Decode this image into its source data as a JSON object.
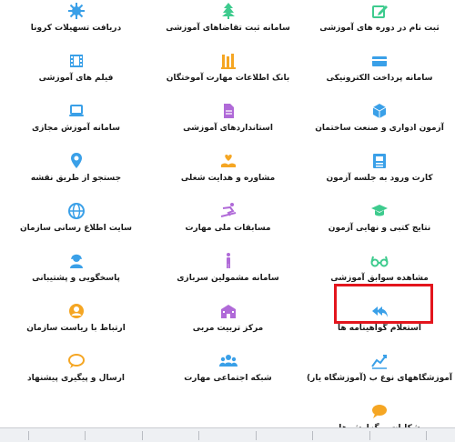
{
  "colors": {
    "orange": "#f5a623",
    "green": "#3ecb8e",
    "blue": "#3aa0e8",
    "pink": "#b06ad8",
    "highlight": "#e3151d"
  },
  "items": [
    {
      "id": "course-registration",
      "label": "ثبت نام در دوره های آموزشی",
      "icon": "edit-icon",
      "color": "green"
    },
    {
      "id": "training-requests",
      "label": "سامانه ثبت تقاضاهای آموزشی",
      "icon": "tree-icon",
      "color": "green"
    },
    {
      "id": "corona-facilities",
      "label": "دریافت تسهیلات کرونا",
      "icon": "virus-icon",
      "color": "blue"
    },
    {
      "id": "e-payment",
      "label": "سامانه پرداخت الکترونیکی",
      "icon": "card-icon",
      "color": "blue"
    },
    {
      "id": "skilled-bank",
      "label": "بانک اطلاعات مهارت آموختگان",
      "icon": "library-icon",
      "color": "orange"
    },
    {
      "id": "training-films",
      "label": "فیلم های آموزشی",
      "icon": "film-icon",
      "color": "blue"
    },
    {
      "id": "construction-exam",
      "label": "آزمون ادواری و صنعت ساختمان",
      "icon": "cube-icon",
      "color": "blue"
    },
    {
      "id": "training-standards",
      "label": "استانداردهای آموزشی",
      "icon": "file-icon",
      "color": "pink"
    },
    {
      "id": "virtual-training",
      "label": "سامانه آموزش مجازی",
      "icon": "laptop-icon",
      "color": "blue"
    },
    {
      "id": "exam-entry-card",
      "label": "کارت ورود به جلسه آزمون",
      "icon": "id-card-icon",
      "color": "blue"
    },
    {
      "id": "career-guidance",
      "label": "مشاوره و هدایت شغلی",
      "icon": "hand-heart-icon",
      "color": "orange"
    },
    {
      "id": "map-search",
      "label": "جستجو از طریق نقشه",
      "icon": "map-pin-icon",
      "color": "blue"
    },
    {
      "id": "exam-results",
      "label": "نتایج کتبی و نهایی آزمون",
      "icon": "graduation-icon",
      "color": "green"
    },
    {
      "id": "skill-competitions",
      "label": "مسابقات ملی مهارت",
      "icon": "skier-icon",
      "color": "pink"
    },
    {
      "id": "info-site",
      "label": "سایت اطلاع رسانی سازمان",
      "icon": "globe-icon",
      "color": "blue"
    },
    {
      "id": "training-records",
      "label": "مشاهده سوابق آموزشی",
      "icon": "glasses-icon",
      "color": "green"
    },
    {
      "id": "conscripts-system",
      "label": "سامانه مشمولین سربازی",
      "icon": "person-icon",
      "color": "pink"
    },
    {
      "id": "support",
      "label": "پاسخگویی و پشتیبانی",
      "icon": "support-icon",
      "color": "blue"
    },
    {
      "id": "certificate-inquiry",
      "label": "استعلام گواهینامه ها",
      "icon": "reply-all-icon",
      "color": "blue",
      "highlighted": true
    },
    {
      "id": "trainer-center",
      "label": "مرکز تربیت مربی",
      "icon": "school-icon",
      "color": "pink"
    },
    {
      "id": "contact-president",
      "label": "ارتباط با ریاست سازمان",
      "icon": "user-circle-icon",
      "color": "orange"
    },
    {
      "id": "private-institutes",
      "label": "آموزشگاههای نوع ب (آموزشگاه یار)",
      "icon": "chart-icon",
      "color": "blue"
    },
    {
      "id": "social-network",
      "label": "شبکه اجتماعی مهارت",
      "icon": "users-icon",
      "color": "blue"
    },
    {
      "id": "suggestions",
      "label": "ارسال و پیگیری پیشنهاد",
      "icon": "comment-icon",
      "color": "orange"
    },
    {
      "id": "complaints",
      "label": "شکایات و گزارش ها",
      "icon": "comments-icon",
      "color": "orange"
    }
  ]
}
